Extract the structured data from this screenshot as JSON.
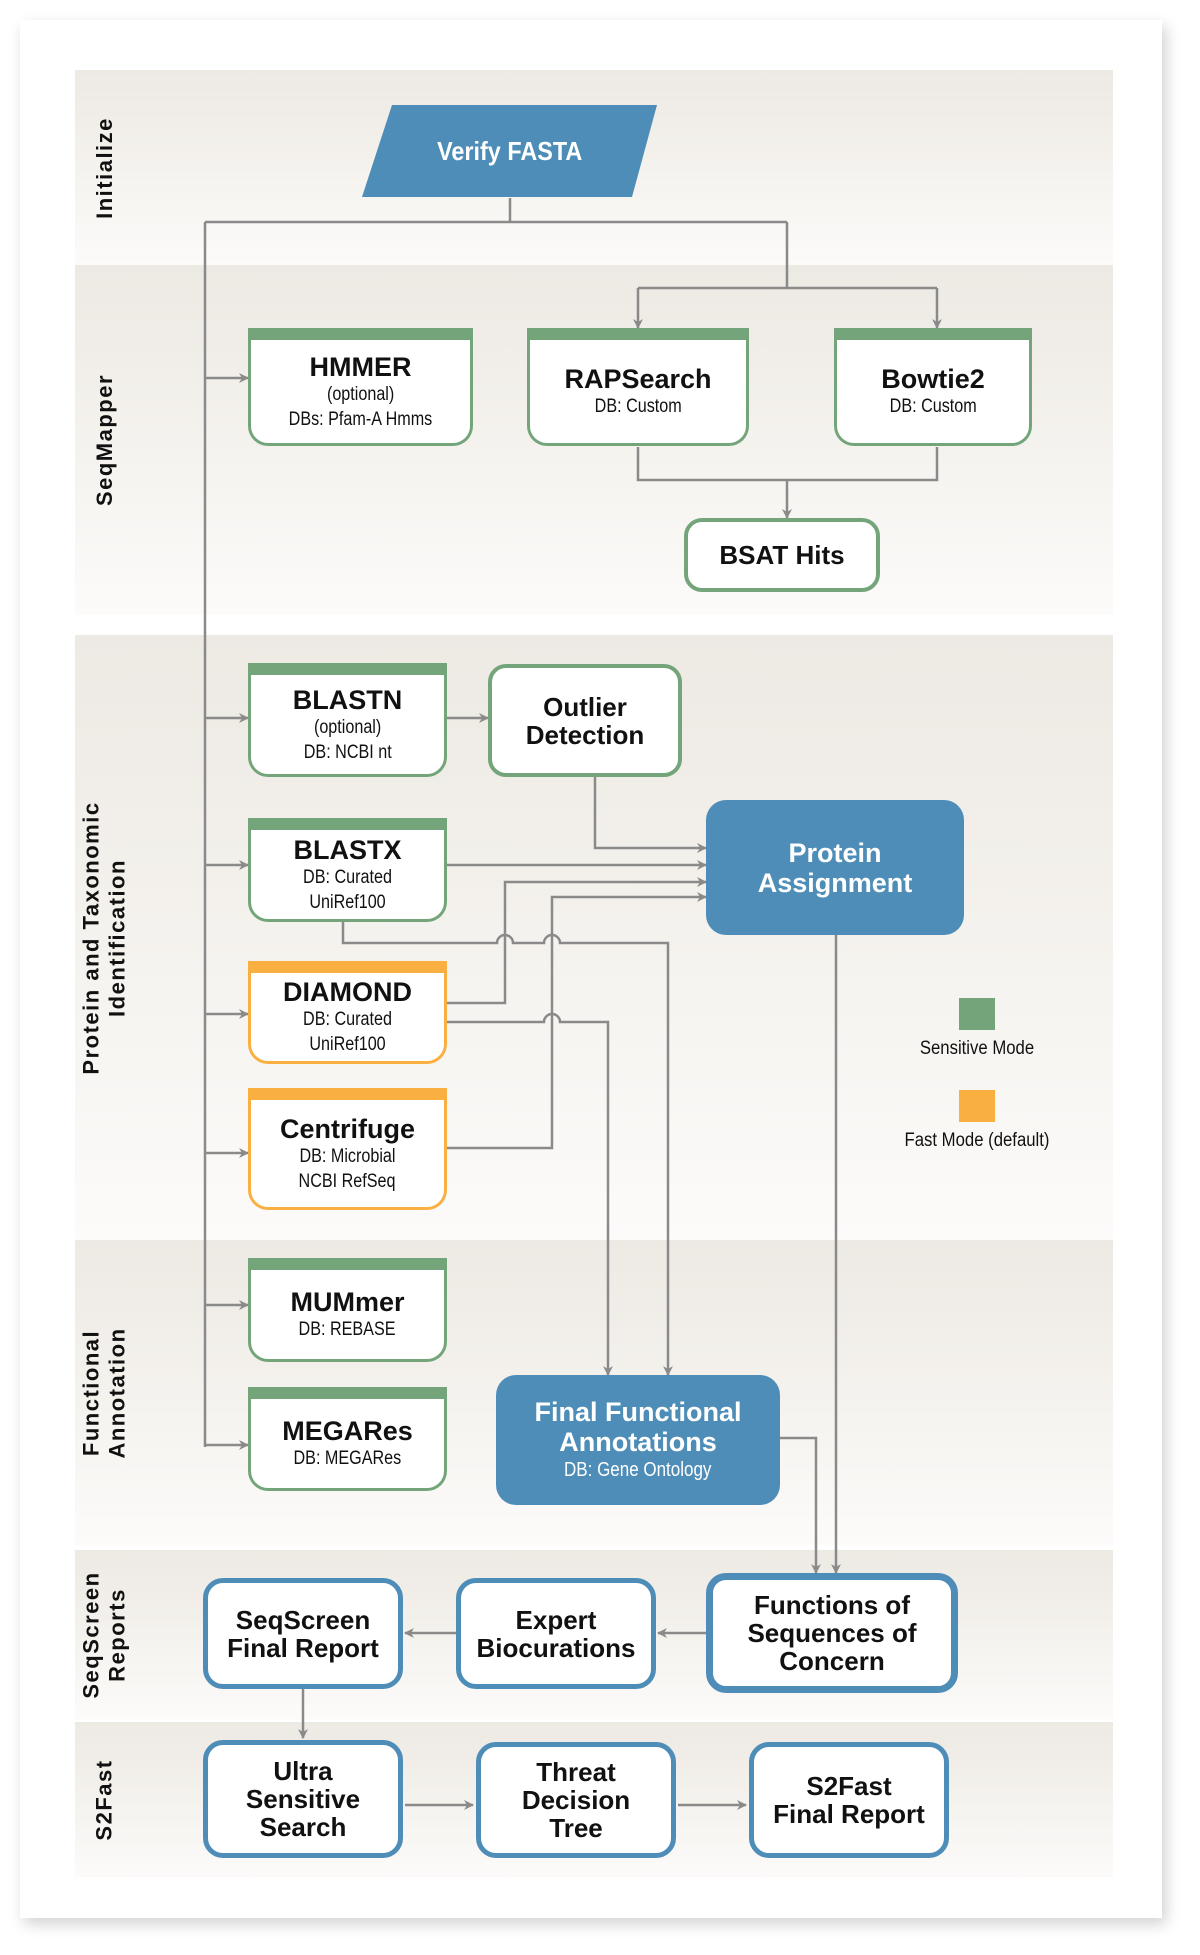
{
  "colors": {
    "sensitive": "#74a57a",
    "fast": "#f9b040",
    "process_blue": "#4e8db8",
    "connector": "#8a8a8a"
  },
  "lanes": [
    {
      "id": "initialize",
      "label": "Initialize"
    },
    {
      "id": "seqmapper",
      "label": "SeqMapper"
    },
    {
      "id": "protein_tax",
      "label": "Protein and Taxonomic Identification",
      "label_line1": "Protein and Taxonomic",
      "label_line2": "Identification"
    },
    {
      "id": "functional",
      "label": "Functional Annotation",
      "label_line1": "Functional",
      "label_line2": "Annotation"
    },
    {
      "id": "reports",
      "label": "SeqScreen Reports",
      "label_line1": "SeqScreen",
      "label_line2": "Reports"
    },
    {
      "id": "s2fast",
      "label": "S2Fast"
    }
  ],
  "nodes": {
    "verify_fasta": {
      "title": "Verify FASTA"
    },
    "hmmer": {
      "title": "HMMER",
      "note": "(optional)",
      "db": "DBs: Pfam-A Hmms",
      "mode": "sensitive"
    },
    "rapsearch": {
      "title": "RAPSearch",
      "db": "DB: Custom",
      "mode": "sensitive"
    },
    "bowtie2": {
      "title": "Bowtie2",
      "db": "DB: Custom",
      "mode": "sensitive"
    },
    "bsat_hits": {
      "title": "BSAT Hits"
    },
    "blastn": {
      "title": "BLASTN",
      "note": "(optional)",
      "db": "DB: NCBI nt",
      "mode": "sensitive"
    },
    "outlier": {
      "title_line1": "Outlier",
      "title_line2": "Detection"
    },
    "blastx": {
      "title": "BLASTX",
      "db": "DB: Curated UniRef100",
      "mode": "sensitive"
    },
    "diamond": {
      "title": "DIAMOND",
      "db": "DB: Curated UniRef100",
      "mode": "fast"
    },
    "centrifuge": {
      "title": "Centrifuge",
      "db_line1": "DB: Microbial",
      "db_line2": "NCBI RefSeq",
      "mode": "fast"
    },
    "protein_assignment": {
      "title_line1": "Protein",
      "title_line2": "Assignment"
    },
    "mummer": {
      "title": "MUMmer",
      "db": "DB: REBASE",
      "mode": "sensitive"
    },
    "megares": {
      "title": "MEGARes",
      "db": "DB: MEGARes",
      "mode": "sensitive"
    },
    "final_functional": {
      "title_line1": "Final Functional",
      "title_line2": "Annotations",
      "db": "DB: Gene Ontology"
    },
    "functions_soc": {
      "title_line1": "Functions of",
      "title_line2": "Sequences of",
      "title_line3": "Concern"
    },
    "expert_biocurations": {
      "title_line1": "Expert",
      "title_line2": "Biocurations"
    },
    "seqscreen_final": {
      "title_line1": "SeqScreen",
      "title_line2": "Final Report"
    },
    "ultra_sensitive": {
      "title_line1": "Ultra",
      "title_line2": "Sensitive",
      "title_line3": "Search"
    },
    "threat_tree": {
      "title_line1": "Threat",
      "title_line2": "Decision",
      "title_line3": "Tree"
    },
    "s2fast_final": {
      "title_line1": "S2Fast",
      "title_line2": "Final Report"
    }
  },
  "legend": {
    "sensitive_label": "Sensitive Mode",
    "fast_label": "Fast Mode (default)"
  }
}
